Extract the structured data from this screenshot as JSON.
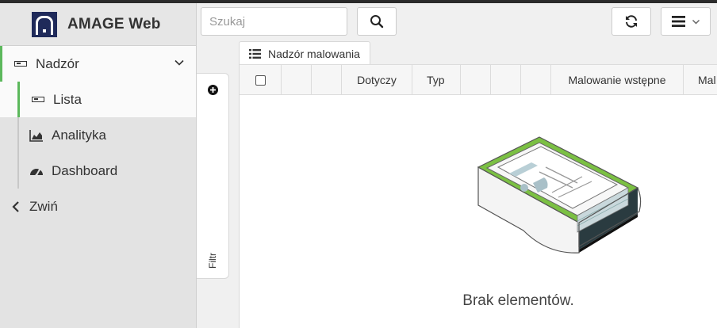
{
  "app": {
    "title": "AMAGE Web"
  },
  "sidebar": {
    "items": [
      {
        "label": "Nadzór",
        "icon": "card-icon"
      },
      {
        "label": "Lista",
        "icon": "card-icon"
      },
      {
        "label": "Analityka",
        "icon": "area-chart-icon"
      },
      {
        "label": "Dashboard",
        "icon": "dashboard-icon"
      },
      {
        "label": "Zwiń",
        "icon": "chevron-left-icon"
      }
    ]
  },
  "search": {
    "placeholder": "Szukaj"
  },
  "filter": {
    "label": "Filtr"
  },
  "tab": {
    "label": "Nadzór malowania"
  },
  "table": {
    "columns": [
      "",
      "",
      "",
      "Dotyczy",
      "Typ",
      "",
      "",
      "",
      "Malowanie wstępne",
      "Mal"
    ]
  },
  "empty": {
    "message": "Brak elementów."
  },
  "colors": {
    "accent": "#5cb85c",
    "logo": "#1f2a5a"
  }
}
